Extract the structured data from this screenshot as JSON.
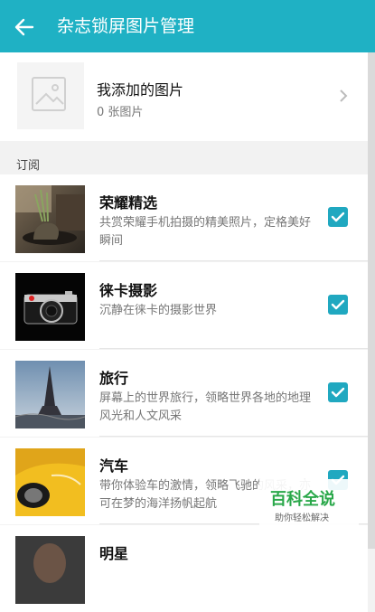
{
  "header": {
    "title": "杂志锁屏图片管理"
  },
  "my_images": {
    "title": "我添加的图片",
    "count": "0 张图片"
  },
  "section_label": "订阅",
  "subscriptions": [
    {
      "name": "荣耀精选",
      "desc": "共赏荣耀手机拍摄的精美照片，定格美好瞬间",
      "checked": true
    },
    {
      "name": "徕卡摄影",
      "desc": "沉静在徕卡的摄影世界",
      "checked": true
    },
    {
      "name": "旅行",
      "desc": "屏幕上的世界旅行，领略世界各地的地理风光和人文风采",
      "checked": true
    },
    {
      "name": "汽车",
      "desc": "带你体验车的激情，领略飞驰的风采，亦可在梦的海洋扬帆起航",
      "checked": true
    },
    {
      "name": "明星",
      "desc": "",
      "checked": false
    }
  ],
  "watermark": {
    "title": "百科全说",
    "subtitle": "助你轻松解决"
  },
  "colors": {
    "accent": "#1fb1c4",
    "checkbox": "#20a8c0"
  }
}
